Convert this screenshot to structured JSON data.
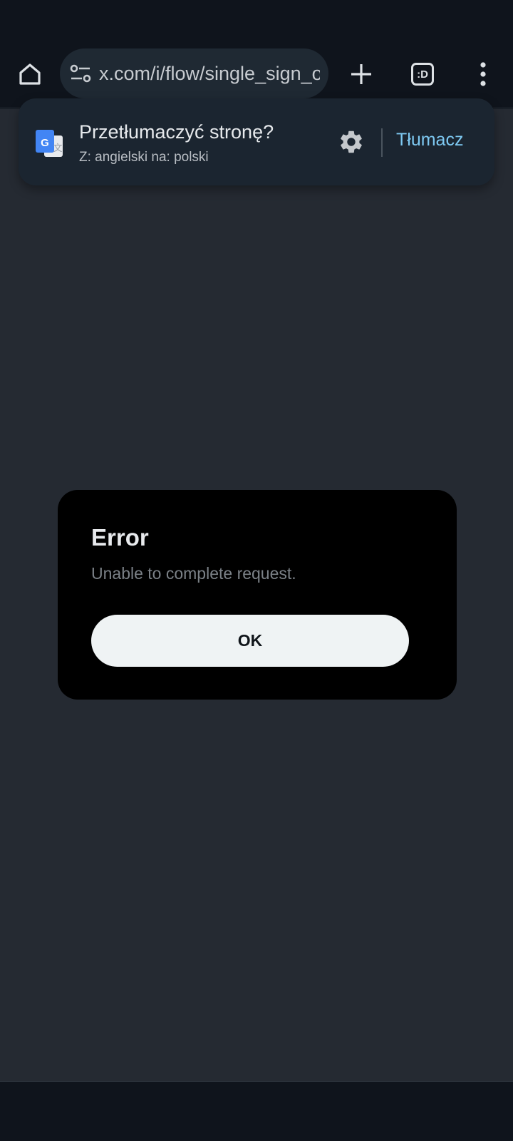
{
  "browser": {
    "url": "x.com/i/flow/single_sign_on",
    "tab_switcher_label": ":D",
    "icons": {
      "home": "home-icon",
      "site_settings": "tune-icon",
      "new_tab": "plus-icon",
      "tab_switcher": "tab-switcher-icon",
      "menu": "more-vert-icon"
    }
  },
  "translate_bar": {
    "title": "Przetłumaczyć stronę?",
    "subtitle": "Z: angielski na: polski",
    "action_label": "Tłumacz",
    "icons": {
      "logo": "google-translate-icon",
      "settings": "gear-icon"
    },
    "accent_color": "#7ec9f2"
  },
  "dialog": {
    "title": "Error",
    "message": "Unable to complete request.",
    "ok_label": "OK"
  },
  "colors": {
    "page_background": "#252a32",
    "chrome_background": "#0f141c",
    "dialog_background": "#000000",
    "ok_button": "#eff3f4"
  }
}
